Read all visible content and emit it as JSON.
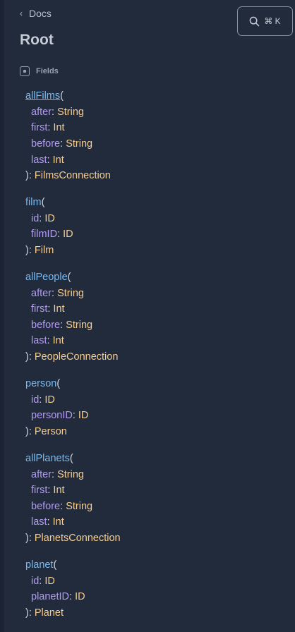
{
  "nav": {
    "back_label": "Docs"
  },
  "search": {
    "shortcut": "⌘ K"
  },
  "page": {
    "title": "Root"
  },
  "section": {
    "label": "Fields"
  },
  "colors": {
    "background": "#222b3b",
    "field_name": "#79b9ef",
    "argument": "#b39bf2",
    "type": "#f5cd92",
    "punctuation": "#d1d6de"
  },
  "icons": {
    "back": "chevron-left-icon",
    "search": "magnifier-icon",
    "section": "box-icon"
  },
  "fields": [
    {
      "name": "allFilms",
      "args": [
        {
          "name": "after",
          "type": "String"
        },
        {
          "name": "first",
          "type": "Int"
        },
        {
          "name": "before",
          "type": "String"
        },
        {
          "name": "last",
          "type": "Int"
        }
      ],
      "return_type": "FilmsConnection"
    },
    {
      "name": "film",
      "args": [
        {
          "name": "id",
          "type": "ID"
        },
        {
          "name": "filmID",
          "type": "ID"
        }
      ],
      "return_type": "Film"
    },
    {
      "name": "allPeople",
      "args": [
        {
          "name": "after",
          "type": "String"
        },
        {
          "name": "first",
          "type": "Int"
        },
        {
          "name": "before",
          "type": "String"
        },
        {
          "name": "last",
          "type": "Int"
        }
      ],
      "return_type": "PeopleConnection"
    },
    {
      "name": "person",
      "args": [
        {
          "name": "id",
          "type": "ID"
        },
        {
          "name": "personID",
          "type": "ID"
        }
      ],
      "return_type": "Person"
    },
    {
      "name": "allPlanets",
      "args": [
        {
          "name": "after",
          "type": "String"
        },
        {
          "name": "first",
          "type": "Int"
        },
        {
          "name": "before",
          "type": "String"
        },
        {
          "name": "last",
          "type": "Int"
        }
      ],
      "return_type": "PlanetsConnection"
    },
    {
      "name": "planet",
      "args": [
        {
          "name": "id",
          "type": "ID"
        },
        {
          "name": "planetID",
          "type": "ID"
        }
      ],
      "return_type": "Planet"
    }
  ]
}
